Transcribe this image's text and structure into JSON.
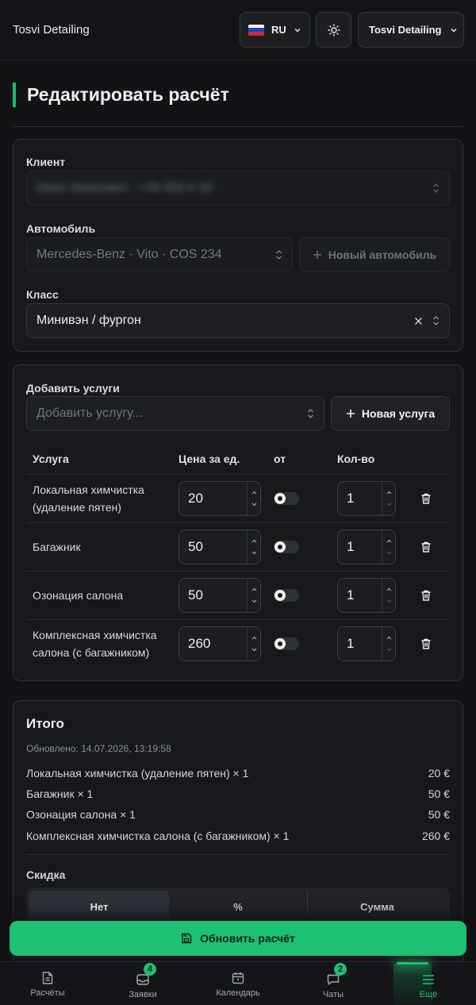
{
  "header": {
    "brand": "Tosvi Detailing",
    "language": "RU",
    "account": "Tosvi Detailing"
  },
  "page": {
    "title": "Редактировать расчёт"
  },
  "vehicle_card": {
    "client_label": "Клиент",
    "client_value": "Иван Иванович · +49 000 0 00",
    "car_label": "Автомобиль",
    "car_value": "Mercedes-Benz · Vito · COS 234",
    "new_car_button": "Новый автомобиль",
    "class_label": "Класс",
    "class_value": "Минивэн / фургон"
  },
  "services_card": {
    "add_label": "Добавить услуги",
    "add_placeholder": "Добавить услугу...",
    "new_service_button": "Новая услуга",
    "columns": {
      "service": "Услуга",
      "price": "Цена за ед.",
      "from": "от",
      "qty": "Кол-во"
    },
    "rows": [
      {
        "name": "Локальная химчистка (удаление пятен)",
        "price": "20",
        "qty": "1"
      },
      {
        "name": "Багажник",
        "price": "50",
        "qty": "1"
      },
      {
        "name": "Озонация салона",
        "price": "50",
        "qty": "1"
      },
      {
        "name": "Комплексная химчистка салона (с багажником)",
        "price": "260",
        "qty": "1"
      }
    ]
  },
  "summary": {
    "title": "Итого",
    "updated": "Обновлено: 14.07.2026, 13:19:58",
    "lines": [
      {
        "label": "Локальная химчистка (удаление пятен) × 1",
        "amount": "20 €"
      },
      {
        "label": "Багажник × 1",
        "amount": "50 €"
      },
      {
        "label": "Озонация салона × 1",
        "amount": "50 €"
      },
      {
        "label": "Комплексная химчистка салона (с багажником) × 1",
        "amount": "260 €"
      }
    ],
    "discount_label": "Скидка",
    "discount_options": [
      "Нет",
      "%",
      "Сумма"
    ]
  },
  "actions": {
    "update_button": "Обновить расчёт"
  },
  "nav": {
    "items": [
      {
        "label": "Расчёты"
      },
      {
        "label": "Заявки",
        "badge": "4"
      },
      {
        "label": "Календарь"
      },
      {
        "label": "Чаты",
        "badge": "2"
      },
      {
        "label": "Ещё"
      }
    ]
  },
  "colors": {
    "accent": "#1ec073",
    "background": "#121316",
    "card": "#17181b"
  }
}
